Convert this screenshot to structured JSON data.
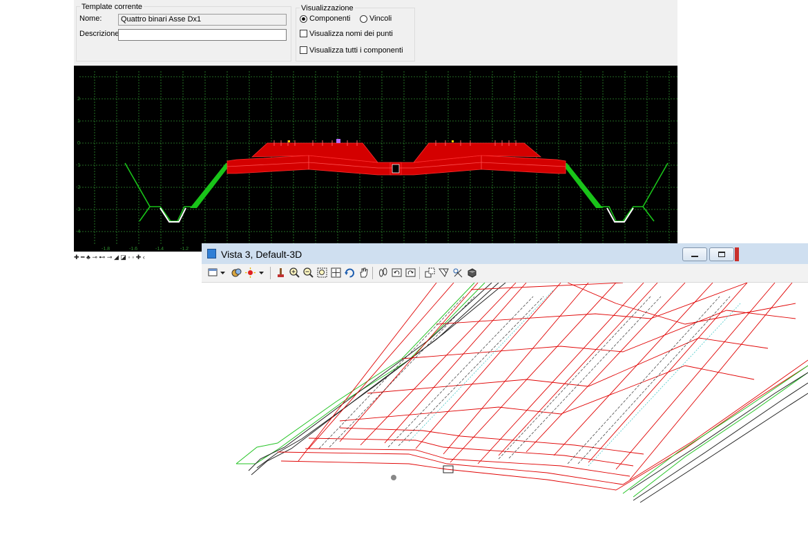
{
  "template_panel": {
    "group_title": "Template corrente",
    "nome_label": "Nome:",
    "nome_value": "Quattro binari Asse Dx1",
    "descrizione_label": "Descrizione:",
    "descrizione_value": ""
  },
  "visualizzazione": {
    "group_title": "Visualizzazione",
    "radio_componenti": "Componenti",
    "radio_vincoli": "Vincoli",
    "selected": "Componenti",
    "check_nomi_punti": "Visualizza nomi dei punti",
    "check_tutti_componenti": "Visualizza tutti i componenti",
    "check_nomi_punti_checked": false,
    "check_tutti_componenti_checked": false
  },
  "cross_section": {
    "y_ticks": [
      "2",
      "1",
      "0",
      "-1",
      "-2",
      "-3",
      "-4"
    ],
    "x_ticks": [
      "-1.8",
      "-1.6",
      "-1.4",
      "-1.2"
    ],
    "toolbar_glyphs": "✚ ━ ♣ ⊸ ⊷ ⊸ ◢ ◪ ◦ ◦ ✚ ‹"
  },
  "view3d": {
    "title": "Vista 3, Default-3D",
    "toolbar_icons": [
      "view-attributes-icon",
      "dropdown-arrow-icon",
      "display-style-icon",
      "lighting-icon",
      "dropdown-arrow-icon",
      "update-view-icon",
      "zoom-in-icon",
      "zoom-out-icon",
      "window-area-icon",
      "fit-view-icon",
      "rotate-view-icon",
      "pan-view-icon",
      "walk-icon",
      "previous-view-icon",
      "next-view-icon",
      "copy-view-icon",
      "view-volume-icon",
      "clip-volume-icon",
      "camera-icon"
    ]
  },
  "colors": {
    "template_red": "#e00000",
    "constraint_green": "#19c419",
    "grid_green": "#2f8f2f",
    "canvas_black": "#000000",
    "titlebar_blue": "#cfdff0"
  }
}
